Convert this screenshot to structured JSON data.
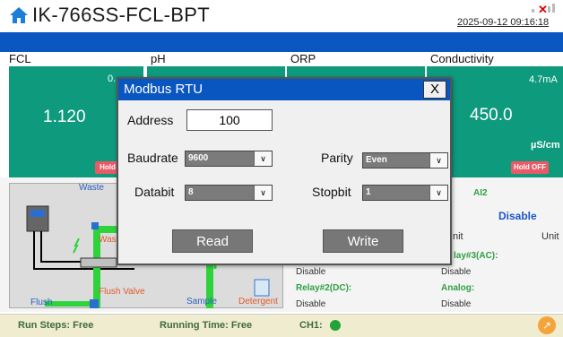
{
  "header": {
    "title": "IK-766SS-FCL-BPT",
    "datetime": "2025-09-12 09:16:18"
  },
  "columns": [
    {
      "label": "FCL"
    },
    {
      "label": "pH"
    },
    {
      "label": "ORP"
    },
    {
      "label": "Conductivity"
    }
  ],
  "panels": {
    "fcl": {
      "value": "1.120",
      "hold": "Hold"
    },
    "conductivity": {
      "current": "4.7mA",
      "value": "450.0",
      "unit": "µS/cm",
      "hold": "Hold OFF"
    },
    "small_fcl_top": "0."
  },
  "dialog": {
    "title": "Modbus RTU",
    "close": "X",
    "address_label": "Address",
    "address_value": "100",
    "baudrate_label": "Baudrate",
    "baudrate_value": "9600",
    "parity_label": "Parity",
    "parity_value": "Even",
    "databit_label": "Databit",
    "databit_value": "8",
    "stopbit_label": "Stopbit",
    "stopbit_value": "1",
    "read_label": "Read",
    "write_label": "Write"
  },
  "diagram": {
    "waste": "Waste",
    "waste_side": "Was",
    "flush": "Flush",
    "flush_valve": "Flush Valve",
    "sample": "Sample",
    "detergent": "Detergent"
  },
  "status": {
    "ai2_label": "AI2",
    "ai2_value": "Disable",
    "unit_left": "nit",
    "unit_right": "Unit",
    "relay3": "lay#3(AC):",
    "disable_a": "Disable",
    "disable_b": "Disable",
    "relay2": "Relay#2(DC):",
    "analog": "Analog:",
    "disable_c": "Disable",
    "disable_d": "Disable"
  },
  "footer": {
    "run_steps": "Run Steps: Free",
    "running_time": "Running Time: Free",
    "ch1": "CH1:"
  },
  "colors": {
    "teal": "#0d9a7d",
    "blue": "#0b57c2",
    "hold_red": "#ea5a66",
    "pipe_green": "#2ed33c"
  }
}
